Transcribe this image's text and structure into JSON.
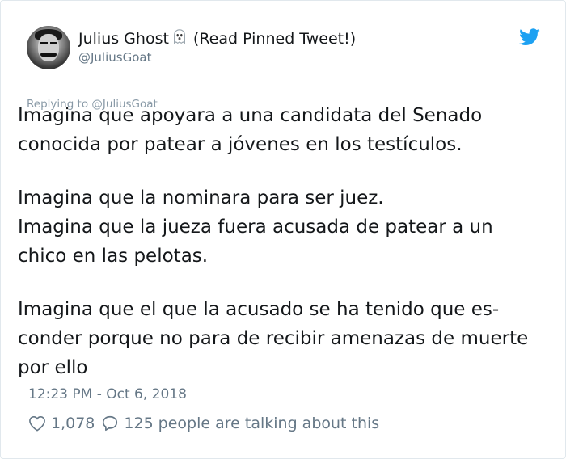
{
  "author": {
    "display_name": "Julius Ghost",
    "name_suffix": "(Read Pinned Tweet!)",
    "handle": "@JuliusGoat",
    "emoji_icon": "ghost-icon"
  },
  "reply_context": "Replying to @JuliusGoat",
  "tweet": {
    "paragraphs": [
      [
        "Imagina que apoyara a una candidata del Senado",
        "conocida por patear a jóvenes en los testículos."
      ],
      [
        "Imagina que la nominara para ser juez.",
        "Imagina que la jueza fuera acusada de patear a un",
        "chico en las pelotas."
      ],
      [
        "Imagina que el que la acusado se ha tenido que es-",
        "conder porque no para de recibir amenazas de muerte",
        "por ello"
      ]
    ]
  },
  "timestamp": "12:23 PM - Oct 6, 2018",
  "stats": {
    "likes": "1,078",
    "replies": "125",
    "talking_label": "people are talking about this"
  },
  "colors": {
    "twitter_blue": "#1da1f2",
    "secondary_text": "#657786",
    "primary_text": "#14171a"
  }
}
